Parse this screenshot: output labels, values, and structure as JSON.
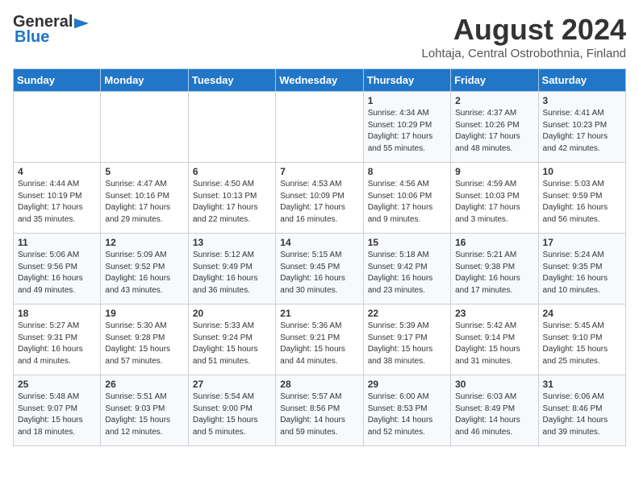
{
  "header": {
    "logo_general": "General",
    "logo_blue": "Blue",
    "main_title": "August 2024",
    "subtitle": "Lohtaja, Central Ostrobothnia, Finland"
  },
  "calendar": {
    "days_of_week": [
      "Sunday",
      "Monday",
      "Tuesday",
      "Wednesday",
      "Thursday",
      "Friday",
      "Saturday"
    ],
    "weeks": [
      [
        {
          "day": "",
          "content": ""
        },
        {
          "day": "",
          "content": ""
        },
        {
          "day": "",
          "content": ""
        },
        {
          "day": "",
          "content": ""
        },
        {
          "day": "1",
          "content": "Sunrise: 4:34 AM\nSunset: 10:29 PM\nDaylight: 17 hours\nand 55 minutes."
        },
        {
          "day": "2",
          "content": "Sunrise: 4:37 AM\nSunset: 10:26 PM\nDaylight: 17 hours\nand 48 minutes."
        },
        {
          "day": "3",
          "content": "Sunrise: 4:41 AM\nSunset: 10:23 PM\nDaylight: 17 hours\nand 42 minutes."
        }
      ],
      [
        {
          "day": "4",
          "content": "Sunrise: 4:44 AM\nSunset: 10:19 PM\nDaylight: 17 hours\nand 35 minutes."
        },
        {
          "day": "5",
          "content": "Sunrise: 4:47 AM\nSunset: 10:16 PM\nDaylight: 17 hours\nand 29 minutes."
        },
        {
          "day": "6",
          "content": "Sunrise: 4:50 AM\nSunset: 10:13 PM\nDaylight: 17 hours\nand 22 minutes."
        },
        {
          "day": "7",
          "content": "Sunrise: 4:53 AM\nSunset: 10:09 PM\nDaylight: 17 hours\nand 16 minutes."
        },
        {
          "day": "8",
          "content": "Sunrise: 4:56 AM\nSunset: 10:06 PM\nDaylight: 17 hours\nand 9 minutes."
        },
        {
          "day": "9",
          "content": "Sunrise: 4:59 AM\nSunset: 10:03 PM\nDaylight: 17 hours\nand 3 minutes."
        },
        {
          "day": "10",
          "content": "Sunrise: 5:03 AM\nSunset: 9:59 PM\nDaylight: 16 hours\nand 56 minutes."
        }
      ],
      [
        {
          "day": "11",
          "content": "Sunrise: 5:06 AM\nSunset: 9:56 PM\nDaylight: 16 hours\nand 49 minutes."
        },
        {
          "day": "12",
          "content": "Sunrise: 5:09 AM\nSunset: 9:52 PM\nDaylight: 16 hours\nand 43 minutes."
        },
        {
          "day": "13",
          "content": "Sunrise: 5:12 AM\nSunset: 9:49 PM\nDaylight: 16 hours\nand 36 minutes."
        },
        {
          "day": "14",
          "content": "Sunrise: 5:15 AM\nSunset: 9:45 PM\nDaylight: 16 hours\nand 30 minutes."
        },
        {
          "day": "15",
          "content": "Sunrise: 5:18 AM\nSunset: 9:42 PM\nDaylight: 16 hours\nand 23 minutes."
        },
        {
          "day": "16",
          "content": "Sunrise: 5:21 AM\nSunset: 9:38 PM\nDaylight: 16 hours\nand 17 minutes."
        },
        {
          "day": "17",
          "content": "Sunrise: 5:24 AM\nSunset: 9:35 PM\nDaylight: 16 hours\nand 10 minutes."
        }
      ],
      [
        {
          "day": "18",
          "content": "Sunrise: 5:27 AM\nSunset: 9:31 PM\nDaylight: 16 hours\nand 4 minutes."
        },
        {
          "day": "19",
          "content": "Sunrise: 5:30 AM\nSunset: 9:28 PM\nDaylight: 15 hours\nand 57 minutes."
        },
        {
          "day": "20",
          "content": "Sunrise: 5:33 AM\nSunset: 9:24 PM\nDaylight: 15 hours\nand 51 minutes."
        },
        {
          "day": "21",
          "content": "Sunrise: 5:36 AM\nSunset: 9:21 PM\nDaylight: 15 hours\nand 44 minutes."
        },
        {
          "day": "22",
          "content": "Sunrise: 5:39 AM\nSunset: 9:17 PM\nDaylight: 15 hours\nand 38 minutes."
        },
        {
          "day": "23",
          "content": "Sunrise: 5:42 AM\nSunset: 9:14 PM\nDaylight: 15 hours\nand 31 minutes."
        },
        {
          "day": "24",
          "content": "Sunrise: 5:45 AM\nSunset: 9:10 PM\nDaylight: 15 hours\nand 25 minutes."
        }
      ],
      [
        {
          "day": "25",
          "content": "Sunrise: 5:48 AM\nSunset: 9:07 PM\nDaylight: 15 hours\nand 18 minutes."
        },
        {
          "day": "26",
          "content": "Sunrise: 5:51 AM\nSunset: 9:03 PM\nDaylight: 15 hours\nand 12 minutes."
        },
        {
          "day": "27",
          "content": "Sunrise: 5:54 AM\nSunset: 9:00 PM\nDaylight: 15 hours\nand 5 minutes."
        },
        {
          "day": "28",
          "content": "Sunrise: 5:57 AM\nSunset: 8:56 PM\nDaylight: 14 hours\nand 59 minutes."
        },
        {
          "day": "29",
          "content": "Sunrise: 6:00 AM\nSunset: 8:53 PM\nDaylight: 14 hours\nand 52 minutes."
        },
        {
          "day": "30",
          "content": "Sunrise: 6:03 AM\nSunset: 8:49 PM\nDaylight: 14 hours\nand 46 minutes."
        },
        {
          "day": "31",
          "content": "Sunrise: 6:06 AM\nSunset: 8:46 PM\nDaylight: 14 hours\nand 39 minutes."
        }
      ]
    ]
  }
}
